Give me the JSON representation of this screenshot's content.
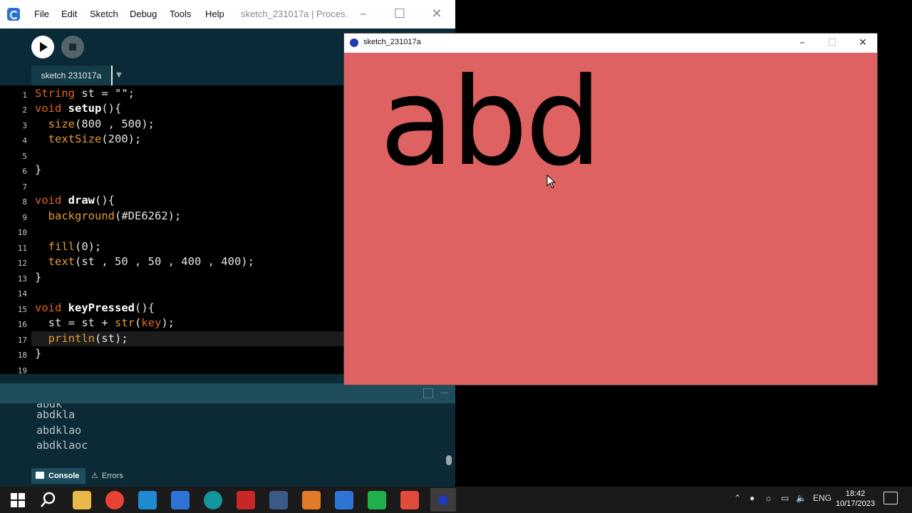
{
  "ide": {
    "menu": [
      "File",
      "Edit",
      "Sketch",
      "Debug",
      "Tools",
      "Help"
    ],
    "title": "sketch_231017a | Proces...",
    "tab_label": "sketch 231017a",
    "colors": {
      "background": "#0b2a35",
      "accent": "#1e4d5c"
    }
  },
  "editor": {
    "line_numbers": [
      "1",
      "2",
      "3",
      "4",
      "5",
      "6",
      "7",
      "8",
      "9",
      "10",
      "11",
      "12",
      "13",
      "14",
      "15",
      "16",
      "17",
      "18",
      "19"
    ],
    "lines": [
      "String st = \"\";",
      "void setup(){",
      "  size(800 , 500);",
      "  textSize(200);",
      "",
      "}",
      "",
      "void draw(){",
      "  background(#DE6262);",
      "",
      "  fill(0);",
      "  text(st , 50 , 50 , 400 , 400);",
      "}",
      "",
      "void keyPressed(){",
      "  st = st + str(key);",
      "  println(st);",
      "}",
      ""
    ],
    "current_line": 17
  },
  "console": {
    "lines": [
      "abdk",
      "abdkla",
      "abdklao",
      "abdklaoc"
    ],
    "tabs": {
      "console": "Console",
      "errors": "Errors"
    }
  },
  "sketch": {
    "title": "sketch_231017a",
    "text": "abd",
    "background": "#DE6262"
  },
  "taskbar": {
    "language": "ENG",
    "time": "18:42",
    "date": "10/17/2023"
  }
}
